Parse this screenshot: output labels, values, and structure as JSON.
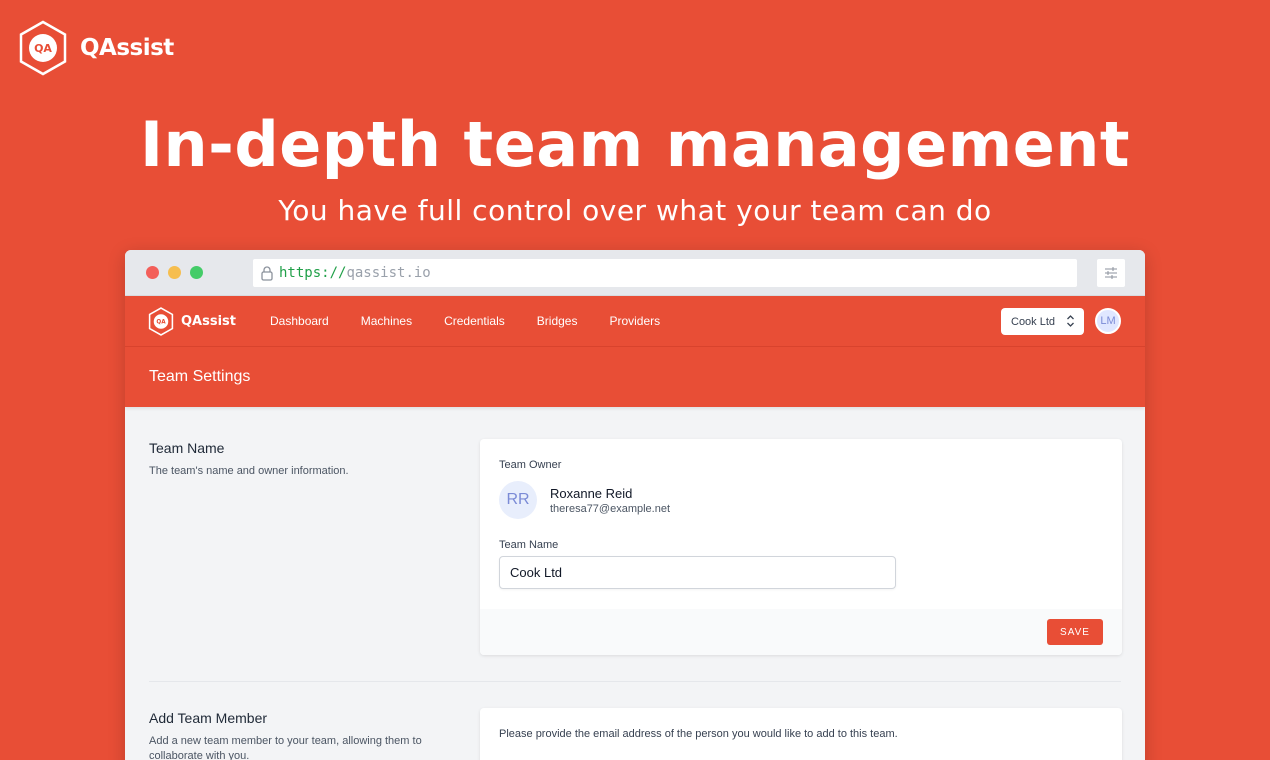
{
  "brand": {
    "name": "QAssist",
    "logo_text": "QA"
  },
  "hero": {
    "title": "In-depth team management",
    "subtitle": "You have full control over what your team can do"
  },
  "browser": {
    "url_scheme": "https://",
    "url_host": "qassist.io"
  },
  "app_nav": {
    "brand_name": "QAssist",
    "links": [
      "Dashboard",
      "Machines",
      "Credentials",
      "Bridges",
      "Providers"
    ],
    "team_select_value": "Cook Ltd",
    "user_initials": "LM"
  },
  "page": {
    "title": "Team Settings"
  },
  "team_name_section": {
    "title": "Team Name",
    "description": "The team's name and owner information.",
    "owner_label": "Team Owner",
    "owner_initials": "RR",
    "owner_name": "Roxanne Reid",
    "owner_email": "theresa77@example.net",
    "name_label": "Team Name",
    "name_value": "Cook Ltd",
    "save_label": "SAVE"
  },
  "add_member_section": {
    "title": "Add Team Member",
    "description": "Add a new team member to your team, allowing them to collaborate with you.",
    "instructions": "Please provide the email address of the person you would like to add to this team."
  },
  "colors": {
    "brand": "#e84e36",
    "url_scheme": "#21a049"
  }
}
